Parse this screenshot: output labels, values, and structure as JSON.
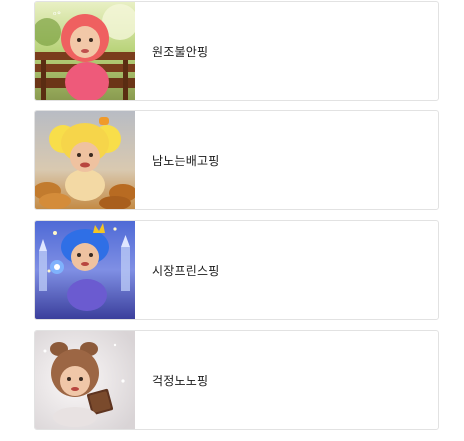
{
  "items": [
    {
      "label": "원조불안핑",
      "thumbnail": "pink-haired-character-on-park-bench"
    },
    {
      "label": "남노는배고핑",
      "thumbnail": "yellow-haired-character-with-food"
    },
    {
      "label": "시장프린스핑",
      "thumbnail": "blue-haired-prince-character-in-fantasy-city"
    },
    {
      "label": "걱정노노핑",
      "thumbnail": "brown-haired-character-with-chocolate"
    }
  ]
}
